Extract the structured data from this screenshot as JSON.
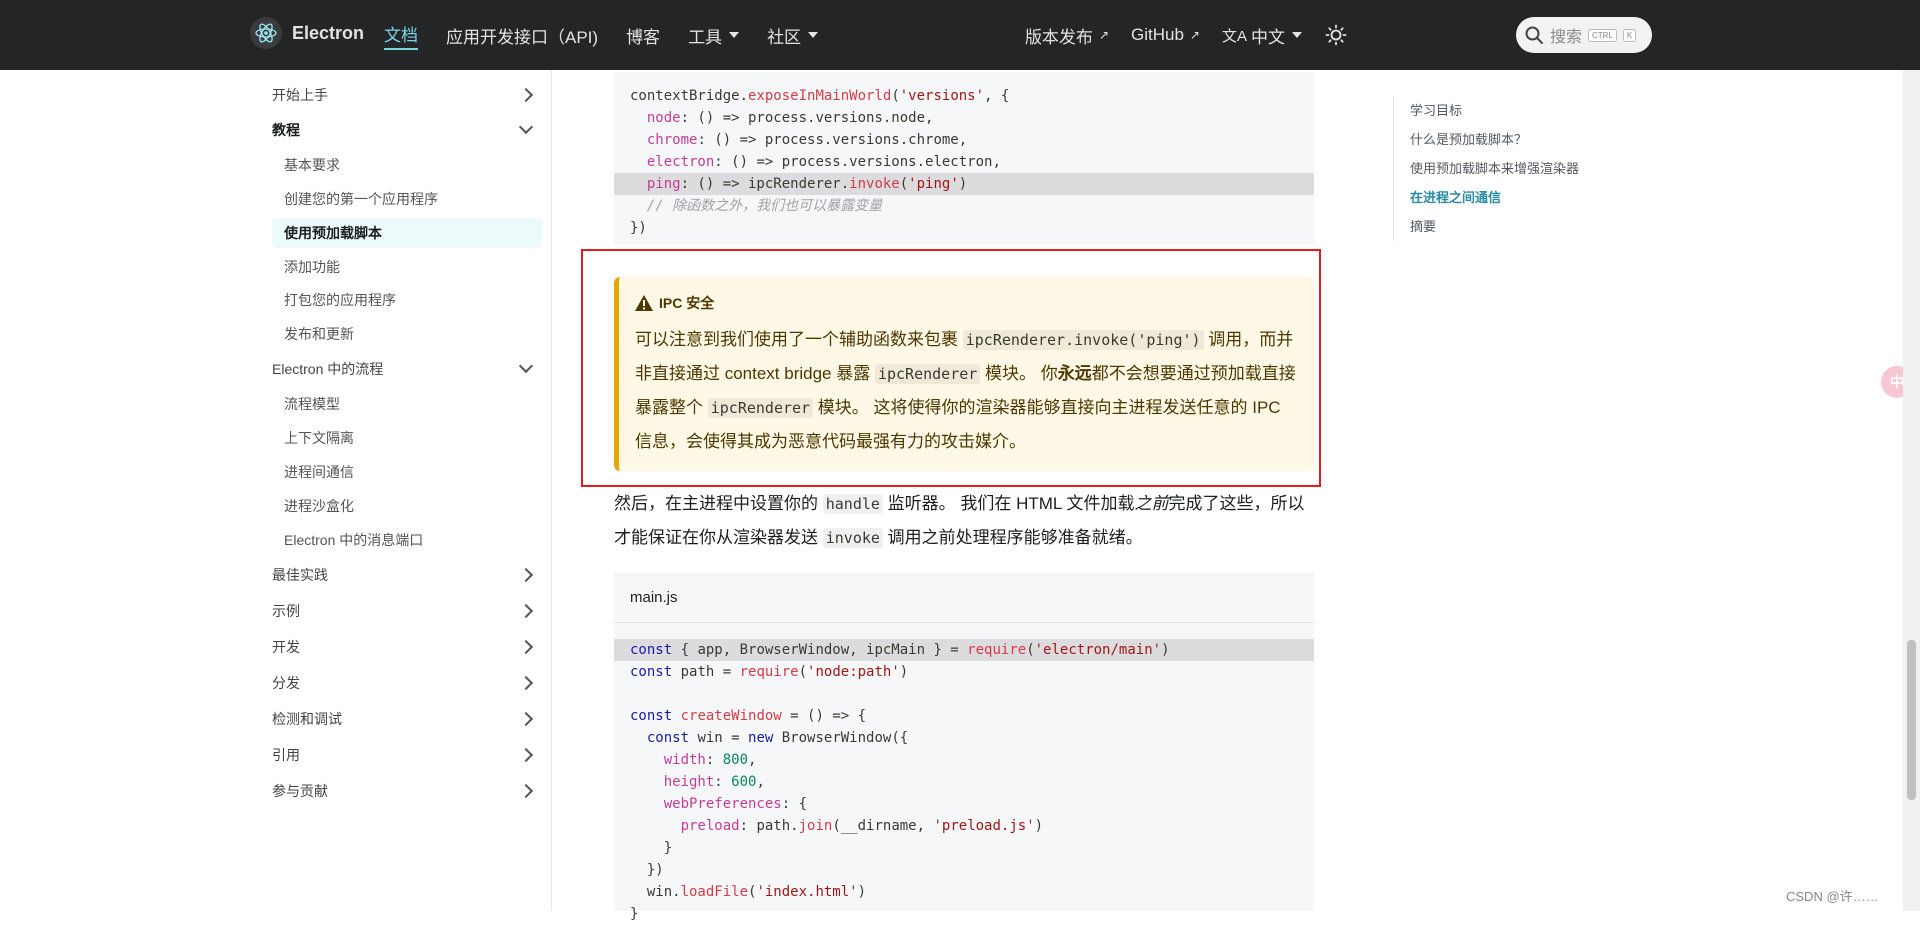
{
  "navbar": {
    "brand": "Electron",
    "links": [
      {
        "label": "文档",
        "active": true
      },
      {
        "label": "应用开发接口（API)"
      },
      {
        "label": "博客"
      },
      {
        "label": "工具",
        "dropdown": true
      },
      {
        "label": "社区",
        "dropdown": true
      }
    ],
    "right": {
      "releases": "版本发布",
      "github": "GitHub",
      "language": "中文"
    },
    "search": {
      "placeholder": "搜索",
      "key1": "CTRL",
      "key2": "K"
    }
  },
  "sidebar": {
    "items": [
      {
        "label": "开始上手",
        "type": "category",
        "expanded": false
      },
      {
        "label": "教程",
        "type": "category",
        "expanded": true,
        "bold": true
      },
      {
        "label": "基本要求",
        "type": "sub"
      },
      {
        "label": "创建您的第一个应用程序",
        "type": "sub"
      },
      {
        "label": "使用预加载脚本",
        "type": "sub",
        "active": true
      },
      {
        "label": "添加功能",
        "type": "sub"
      },
      {
        "label": "打包您的应用程序",
        "type": "sub"
      },
      {
        "label": "发布和更新",
        "type": "sub"
      },
      {
        "label": "Electron 中的流程",
        "type": "category",
        "expanded": true
      },
      {
        "label": "流程模型",
        "type": "sub"
      },
      {
        "label": "上下文隔离",
        "type": "sub"
      },
      {
        "label": "进程间通信",
        "type": "sub"
      },
      {
        "label": "进程沙盒化",
        "type": "sub"
      },
      {
        "label": "Electron 中的消息端口",
        "type": "sub"
      },
      {
        "label": "最佳实践",
        "type": "category"
      },
      {
        "label": "示例",
        "type": "category"
      },
      {
        "label": "开发",
        "type": "category"
      },
      {
        "label": "分发",
        "type": "category"
      },
      {
        "label": "检测和调试",
        "type": "category"
      },
      {
        "label": "引用",
        "type": "category"
      },
      {
        "label": "参与贡献",
        "type": "category"
      }
    ]
  },
  "code1": {
    "lines": [
      "contextBridge.exposeInMainWorld('versions', {",
      "  node: () => process.versions.node,",
      "  chrome: () => process.versions.chrome,",
      "  electron: () => process.versions.electron,",
      "  ping: () => ipcRenderer.invoke('ping')",
      "  // 除函数之外，我们也可以暴露变量",
      "})"
    ]
  },
  "admonition": {
    "title": "IPC 安全",
    "p1": "可以注意到我们使用了一个辅助函数来包裹 ",
    "code1": "ipcRenderer.invoke('ping')",
    "p2": " 调用，而并非直接通过 context bridge 暴露 ",
    "code2": "ipcRenderer",
    "p3": " 模块。 你",
    "strong": "永远",
    "p4": "都不会想要通过预加载直接暴露整个 ",
    "code3": "ipcRenderer",
    "p5": " 模块。 这将使得你的渲染器能够直接向主进程发送任意的 IPC 信息，会使得其成为恶意代码最强有力的攻击媒介。"
  },
  "paragraph": {
    "t1": "然后，在主进程中设置你的 ",
    "c1": "handle",
    "t2": " 监听器。 我们在 HTML 文件加载",
    "em": "之前",
    "t3": "完成了这些，所以才能保证在你从渲染器发送 ",
    "c2": "invoke",
    "t4": " 调用之前处理程序能够准备就绪。"
  },
  "code2": {
    "filename": "main.js",
    "lines": [
      "const { app, BrowserWindow, ipcMain } = require('electron/main')",
      "const path = require('node:path')",
      "",
      "const createWindow = () => {",
      "  const win = new BrowserWindow({",
      "    width: 800,",
      "    height: 600,",
      "    webPreferences: {",
      "      preload: path.join(__dirname, 'preload.js')",
      "    }",
      "  })",
      "  win.loadFile('index.html')",
      "}"
    ]
  },
  "toc": {
    "items": [
      {
        "label": "学习目标"
      },
      {
        "label": "什么是预加载脚本？"
      },
      {
        "label": "使用预加载脚本来增强渲染器"
      },
      {
        "label": "在进程之间通信",
        "active": true
      },
      {
        "label": "摘要"
      }
    ]
  },
  "float_button": "中",
  "watermark": "CSDN @许……",
  "colors": {
    "navbar_bg": "#242526",
    "accent": "#79d4e8",
    "warning_bg": "#fff8e6",
    "warning_border": "#e6a700",
    "highlight_box": "#e02020"
  }
}
